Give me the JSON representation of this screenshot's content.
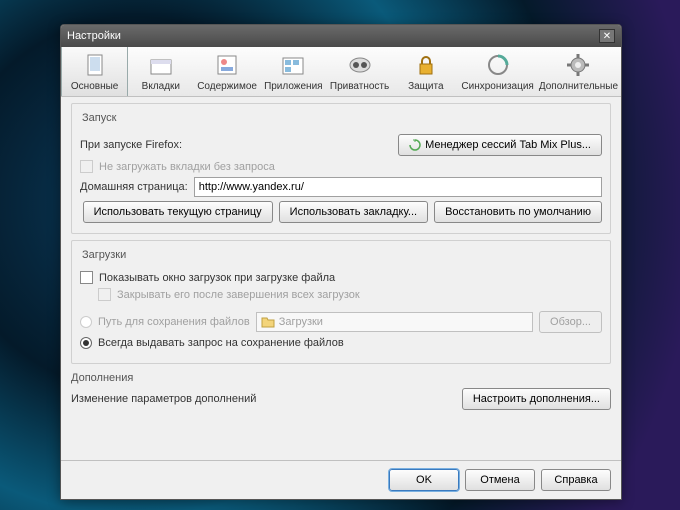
{
  "window": {
    "title": "Настройки"
  },
  "toolbar": {
    "items": [
      {
        "label": "Основные"
      },
      {
        "label": "Вкладки"
      },
      {
        "label": "Содержимое"
      },
      {
        "label": "Приложения"
      },
      {
        "label": "Приватность"
      },
      {
        "label": "Защита"
      },
      {
        "label": "Синхронизация"
      },
      {
        "label": "Дополнительные"
      }
    ]
  },
  "startup": {
    "legend": "Запуск",
    "on_start_label": "При запуске Firefox:",
    "session_mgr_btn": "Менеджер сессий Tab Mix Plus...",
    "dont_load_tabs": "Не загружать вкладки без запроса",
    "homepage_label": "Домашняя страница:",
    "homepage_value": "http://www.yandex.ru/",
    "use_current": "Использовать текущую страницу",
    "use_bookmark": "Использовать закладку...",
    "restore_default": "Восстановить по умолчанию"
  },
  "downloads": {
    "legend": "Загрузки",
    "show_window": "Показывать окно загрузок при загрузке файла",
    "close_after": "Закрывать его после завершения всех загрузок",
    "save_path_label": "Путь для сохранения файлов",
    "folder_name": "Загрузки",
    "browse": "Обзор...",
    "always_ask": "Всегда выдавать запрос на сохранение файлов"
  },
  "addons": {
    "legend": "Дополнения",
    "desc": "Изменение параметров дополнений",
    "configure": "Настроить дополнения..."
  },
  "footer": {
    "ok": "OK",
    "cancel": "Отмена",
    "help": "Справка"
  }
}
